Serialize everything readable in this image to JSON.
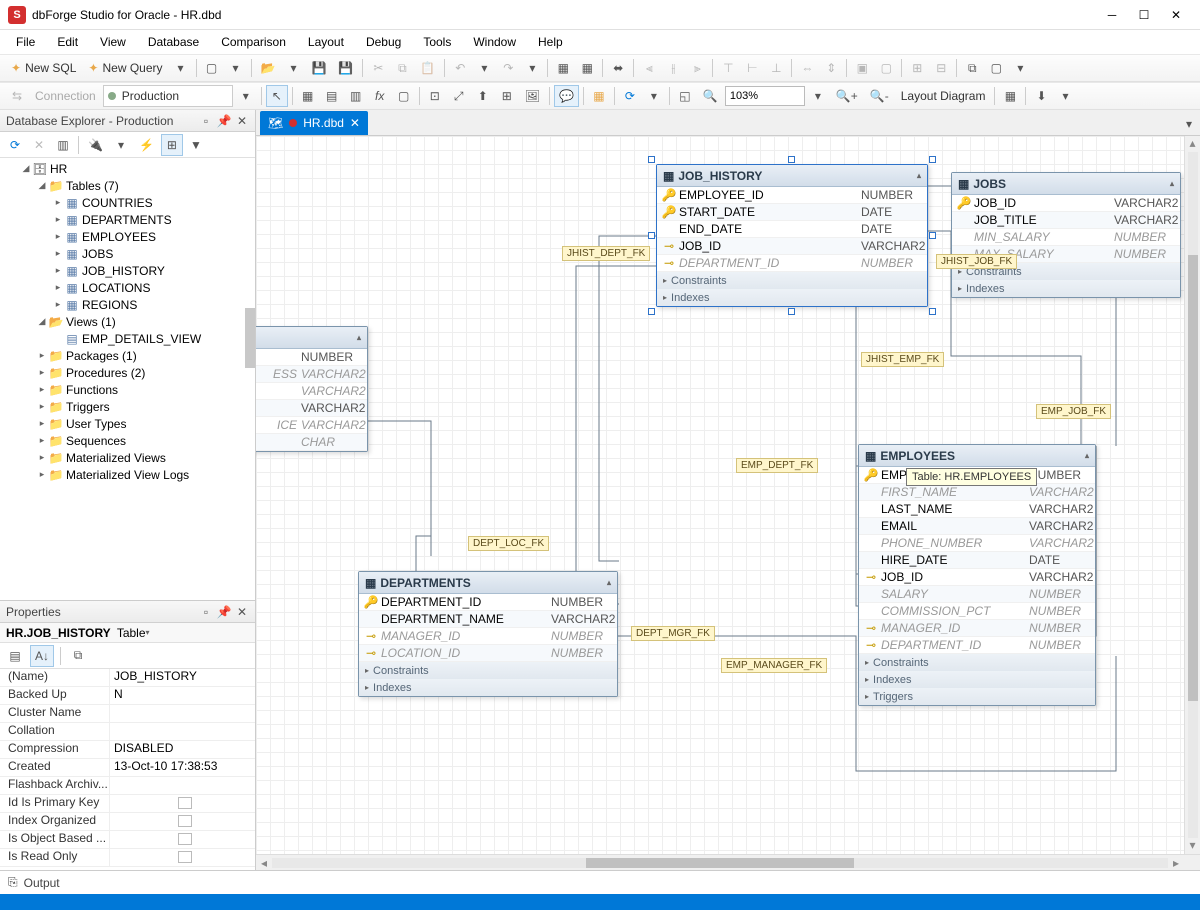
{
  "title": "dbForge Studio for Oracle - HR.dbd",
  "menu": [
    "File",
    "Edit",
    "View",
    "Database",
    "Comparison",
    "Layout",
    "Debug",
    "Tools",
    "Window",
    "Help"
  ],
  "toolbar1": {
    "newsql": "New SQL",
    "newquery": "New Query"
  },
  "toolbar2": {
    "connection": "Connection",
    "conn_name": "Production",
    "zoom": "103%",
    "layout": "Layout Diagram"
  },
  "explorer": {
    "title": "Database Explorer - Production",
    "db": "HR",
    "tables_label": "Tables (7)",
    "tables": [
      "COUNTRIES",
      "DEPARTMENTS",
      "EMPLOYEES",
      "JOBS",
      "JOB_HISTORY",
      "LOCATIONS",
      "REGIONS"
    ],
    "views_label": "Views (1)",
    "views": [
      "EMP_DETAILS_VIEW"
    ],
    "folders": [
      "Packages (1)",
      "Procedures (2)",
      "Functions",
      "Triggers",
      "User Types",
      "Sequences",
      "Materialized Views",
      "Materialized View Logs"
    ]
  },
  "properties": {
    "title": "Properties",
    "subject": "HR.JOB_HISTORY",
    "subject_type": "Table",
    "rows": [
      {
        "name": "(Name)",
        "value": "JOB_HISTORY"
      },
      {
        "name": "Backed Up",
        "value": "N"
      },
      {
        "name": "Cluster Name",
        "value": ""
      },
      {
        "name": "Collation",
        "value": ""
      },
      {
        "name": "Compression",
        "value": "DISABLED"
      },
      {
        "name": "Created",
        "value": "13-Oct-10 17:38:53"
      },
      {
        "name": "Flashback Archiv...",
        "value": ""
      },
      {
        "name": "Id Is Primary Key",
        "value": ""
      },
      {
        "name": "Index Organized",
        "value": ""
      },
      {
        "name": "Is Object Based ...",
        "value": ""
      },
      {
        "name": "Is Read Only",
        "value": ""
      }
    ]
  },
  "tab": {
    "label": "HR.dbd"
  },
  "entities": {
    "job_history": {
      "title": "JOB_HISTORY",
      "cols": [
        {
          "icon": "pk",
          "name": "EMPLOYEE_ID",
          "type": "NUMBER"
        },
        {
          "icon": "pk",
          "name": "START_DATE",
          "type": "DATE"
        },
        {
          "icon": "",
          "name": "END_DATE",
          "type": "DATE"
        },
        {
          "icon": "fk",
          "name": "JOB_ID",
          "type": "VARCHAR2"
        },
        {
          "icon": "fk",
          "name": "DEPARTMENT_ID",
          "type": "NUMBER",
          "nullable": true
        }
      ],
      "sections": [
        "Constraints",
        "Indexes"
      ]
    },
    "jobs": {
      "title": "JOBS",
      "cols": [
        {
          "icon": "pk",
          "name": "JOB_ID",
          "type": "VARCHAR2"
        },
        {
          "icon": "",
          "name": "JOB_TITLE",
          "type": "VARCHAR2"
        },
        {
          "icon": "",
          "name": "MIN_SALARY",
          "type": "NUMBER",
          "nullable": true
        },
        {
          "icon": "",
          "name": "MAX_SALARY",
          "type": "NUMBER",
          "nullable": true
        }
      ],
      "sections": [
        "Constraints",
        "Indexes"
      ]
    },
    "partial": {
      "cols": [
        {
          "name": "",
          "type": "NUMBER"
        },
        {
          "name": "ESS",
          "type": "VARCHAR2",
          "nullable": true
        },
        {
          "name": "",
          "type": "VARCHAR2",
          "nullable": true
        },
        {
          "name": "",
          "type": "VARCHAR2"
        },
        {
          "name": "ICE",
          "type": "VARCHAR2",
          "nullable": true
        },
        {
          "name": "",
          "type": "CHAR",
          "nullable": true
        }
      ]
    },
    "departments": {
      "title": "DEPARTMENTS",
      "cols": [
        {
          "icon": "pk",
          "name": "DEPARTMENT_ID",
          "type": "NUMBER"
        },
        {
          "icon": "",
          "name": "DEPARTMENT_NAME",
          "type": "VARCHAR2"
        },
        {
          "icon": "fk",
          "name": "MANAGER_ID",
          "type": "NUMBER",
          "nullable": true
        },
        {
          "icon": "fk",
          "name": "LOCATION_ID",
          "type": "NUMBER",
          "nullable": true
        }
      ],
      "sections": [
        "Constraints",
        "Indexes"
      ]
    },
    "employees": {
      "title": "EMPLOYEES",
      "cols": [
        {
          "icon": "pk",
          "name": "EMPLOYEE_ID",
          "type": "NUMBER"
        },
        {
          "icon": "",
          "name": "FIRST_NAME",
          "type": "VARCHAR2",
          "nullable": true
        },
        {
          "icon": "",
          "name": "LAST_NAME",
          "type": "VARCHAR2"
        },
        {
          "icon": "",
          "name": "EMAIL",
          "type": "VARCHAR2"
        },
        {
          "icon": "",
          "name": "PHONE_NUMBER",
          "type": "VARCHAR2",
          "nullable": true
        },
        {
          "icon": "",
          "name": "HIRE_DATE",
          "type": "DATE"
        },
        {
          "icon": "fk",
          "name": "JOB_ID",
          "type": "VARCHAR2"
        },
        {
          "icon": "",
          "name": "SALARY",
          "type": "NUMBER",
          "nullable": true
        },
        {
          "icon": "",
          "name": "COMMISSION_PCT",
          "type": "NUMBER",
          "nullable": true
        },
        {
          "icon": "fk",
          "name": "MANAGER_ID",
          "type": "NUMBER",
          "nullable": true
        },
        {
          "icon": "fk",
          "name": "DEPARTMENT_ID",
          "type": "NUMBER",
          "nullable": true
        }
      ],
      "sections": [
        "Constraints",
        "Indexes",
        "Triggers"
      ]
    }
  },
  "rel_labels": {
    "jhist_dept": "JHIST_DEPT_FK",
    "jhist_job": "JHIST_JOB_FK",
    "jhist_emp": "JHIST_EMP_FK",
    "emp_job": "EMP_JOB_FK",
    "emp_dept": "EMP_DEPT_FK",
    "emp_mgr": "EMP_MANAGER_FK",
    "dept_loc": "DEPT_LOC_FK",
    "dept_mgr": "DEPT_MGR_FK"
  },
  "tooltip": "Table: HR.EMPLOYEES",
  "output": "Output"
}
